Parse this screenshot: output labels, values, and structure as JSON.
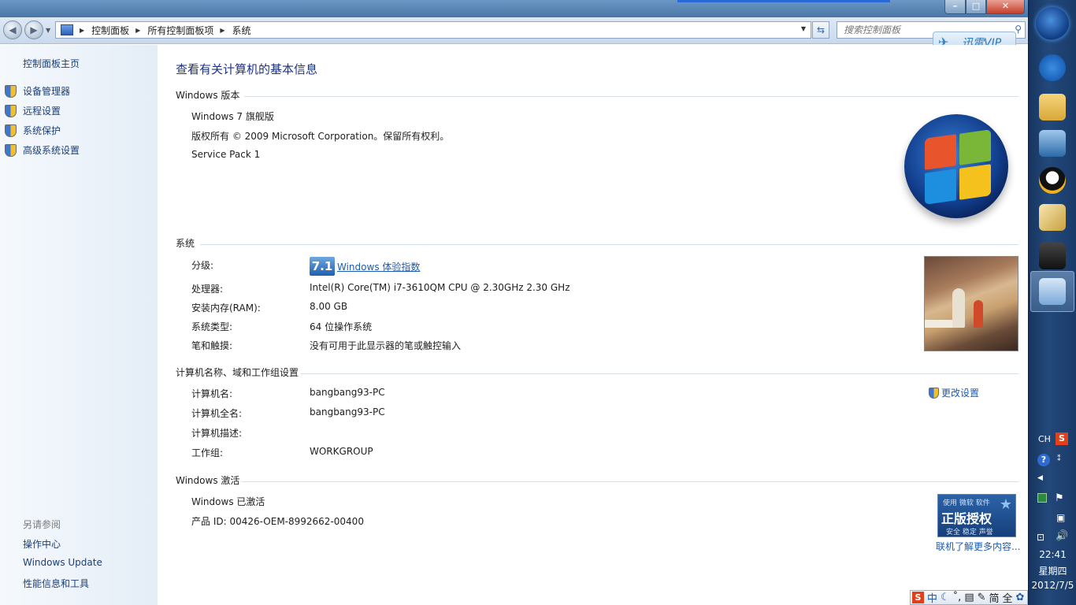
{
  "window": {
    "breadcrumbs": [
      "控制面板",
      "所有控制面板项",
      "系统"
    ],
    "search_placeholder": "搜索控制面板",
    "xunlei_vip": "迅雷VIP"
  },
  "sidebar": {
    "home": "控制面板主页",
    "tasks": [
      {
        "label": "设备管理器"
      },
      {
        "label": "远程设置"
      },
      {
        "label": "系统保护"
      },
      {
        "label": "高级系统设置"
      }
    ],
    "see_also_header": "另请参阅",
    "see_also": [
      {
        "label": "操作中心"
      },
      {
        "label": "Windows Update"
      },
      {
        "label": "性能信息和工具"
      }
    ]
  },
  "main": {
    "title": "查看有关计算机的基本信息",
    "edition": {
      "header": "Windows 版本",
      "name": "Windows 7 旗舰版",
      "copyright": "版权所有 © 2009 Microsoft Corporation。保留所有权利。",
      "service_pack": "Service Pack 1"
    },
    "system": {
      "header": "系统",
      "rating_label": "分级:",
      "rating_score": "7.1",
      "rating_link": "Windows 体验指数",
      "rows": [
        {
          "label": "处理器:",
          "value": "Intel(R) Core(TM) i7-3610QM CPU @ 2.30GHz   2.30 GHz"
        },
        {
          "label": "安装内存(RAM):",
          "value": "8.00 GB"
        },
        {
          "label": "系统类型:",
          "value": "64 位操作系统"
        },
        {
          "label": "笔和触摸:",
          "value": "没有可用于此显示器的笔或触控输入"
        }
      ]
    },
    "computer": {
      "header": "计算机名称、域和工作组设置",
      "change_link": "更改设置",
      "rows": [
        {
          "label": "计算机名:",
          "value": "bangbang93-PC"
        },
        {
          "label": "计算机全名:",
          "value": "bangbang93-PC"
        },
        {
          "label": "计算机描述:",
          "value": ""
        },
        {
          "label": "工作组:",
          "value": "WORKGROUP"
        }
      ]
    },
    "activation": {
      "header": "Windows 激活",
      "status": "Windows 已激活",
      "product_id": "产品 ID: 00426-OEM-8992662-00400",
      "genuine_line1": "使用 微软 软件",
      "genuine_line2": "正版授权",
      "genuine_line3": "安全 稳定 声誉",
      "more_online": "联机了解更多内容..."
    }
  },
  "taskbar": {
    "tray_lang": "CH",
    "time": "22:41",
    "day": "星期四",
    "date": "2012/7/5"
  },
  "ime": {
    "labels": [
      "中",
      "简",
      "全"
    ]
  }
}
